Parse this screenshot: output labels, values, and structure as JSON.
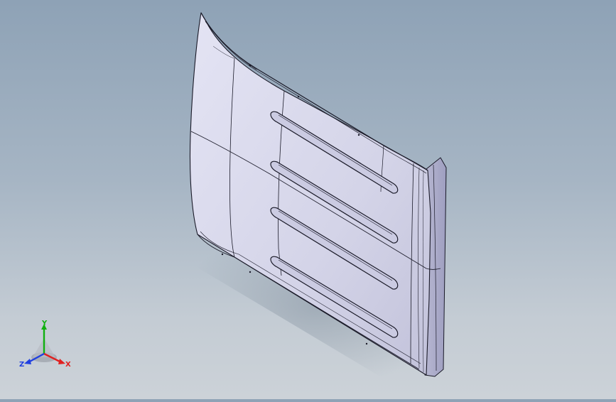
{
  "viewport": {
    "background_top": "#8ea2b6",
    "background_bottom": "#ccd2d8",
    "model_fill": "#d6d6ea",
    "model_edge": "#1a1a28"
  },
  "model": {
    "name": "panel-with-four-slots",
    "slot_count": 4
  },
  "triad": {
    "x_label": "X",
    "y_label": "Y",
    "z_label": "Z",
    "x_color": "#e02020",
    "y_color": "#10b010",
    "z_color": "#2040e0"
  }
}
